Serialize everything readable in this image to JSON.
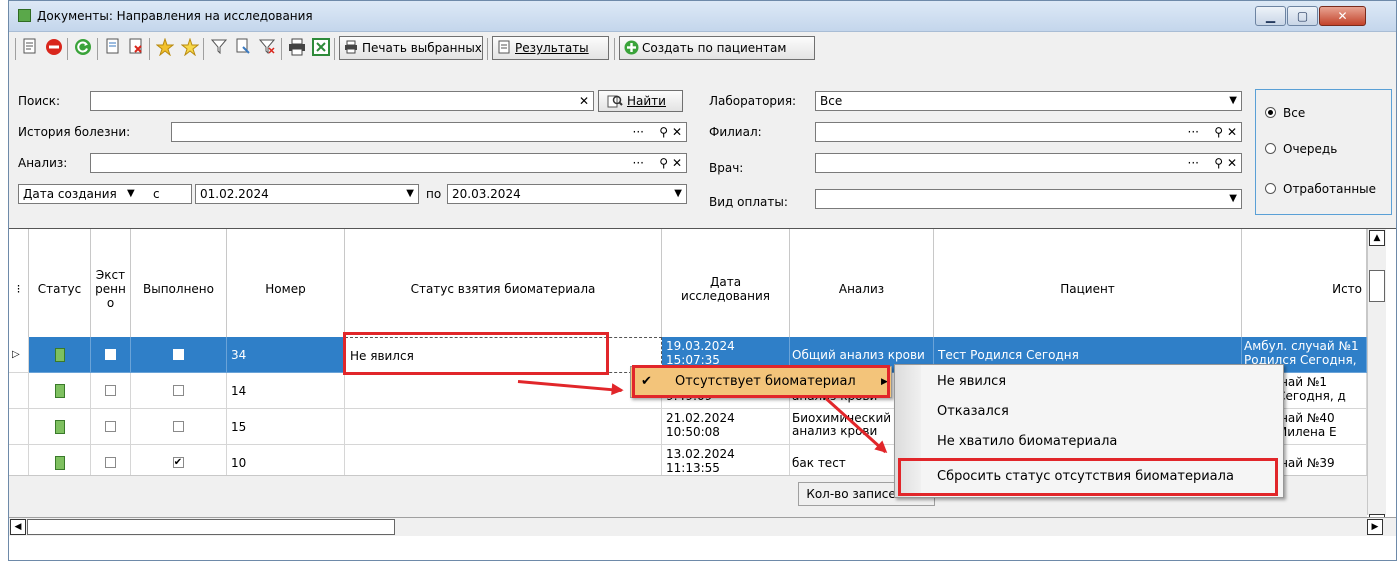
{
  "window": {
    "title": "Документы: Направления на исследования",
    "controls": {
      "minimize": "▁",
      "maximize": "▢",
      "close": "✕"
    }
  },
  "toolbar": {
    "print_selected": "Печать выбранных",
    "results": "Результаты",
    "create_by_patients": "Создать по пациентам"
  },
  "filters": {
    "search_label": "Поиск:",
    "search_value": "",
    "find_button": "Найти",
    "history_label": "История болезни:",
    "analysis_label": "Анализ:",
    "date_type": "Дата создания",
    "from_label": "с",
    "date_from": "01.02.2024",
    "to_label": "по",
    "date_to": "20.03.2024",
    "lab_label": "Лаборатория:",
    "lab_value": "Все",
    "branch_label": "Филиал:",
    "doctor_label": "Врач:",
    "payment_label": "Вид оплаты:",
    "radios": [
      {
        "label": "Все",
        "selected": true
      },
      {
        "label": "Очередь",
        "selected": false
      },
      {
        "label": "Отработанные",
        "selected": false
      }
    ]
  },
  "grid": {
    "columns": [
      "Статус",
      "Экст ренн о",
      "Выполнено",
      "Номер",
      "Статус взятия биоматериала",
      "Дата исследования",
      "Анализ",
      "Пациент",
      "Исто"
    ],
    "rows": [
      {
        "urgent": false,
        "done": false,
        "number": "34",
        "bio_status": "Не явился",
        "date": "19.03.2024",
        "time": "15:07:35",
        "analysis": "Общий анализ крови",
        "patient": "Тест Родился Сегодня",
        "history1": "Амбул. случай №1",
        "history2": "Родился Сегодня, д",
        "selected": true
      },
      {
        "urgent": false,
        "done": false,
        "number": "14",
        "bio_status": "",
        "date": "",
        "time": "9:49:09",
        "analysis": "анализ крови",
        "patient": "",
        "history1": "п. случай №1",
        "history2": "ился Сегодня, д",
        "selected": false
      },
      {
        "urgent": false,
        "done": false,
        "number": "15",
        "bio_status": "",
        "date": "21.02.2024",
        "time": "10:50:08",
        "analysis": "Биохимический анализ крови",
        "patient": "",
        "history1": "п. случай №40",
        "history2": "яева Милена Е",
        "selected": false
      },
      {
        "urgent": false,
        "done": true,
        "number": "10",
        "bio_status": "",
        "date": "13.02.2024",
        "time": "11:13:55",
        "analysis": "бак тест",
        "patient": "",
        "history1": "п. случай №39",
        "history2": "",
        "selected": false
      }
    ],
    "record_count": "Кол-во записей: 24"
  },
  "context_menu": {
    "item": "Отсутствует биоматериал",
    "submenu": [
      "Не явился",
      "Отказался",
      "Не хватило биоматериала",
      "Сбросить статус отсутствия биоматериала"
    ]
  },
  "colors": {
    "selection": "#2f7fc8",
    "annotation": "#e1262a"
  }
}
